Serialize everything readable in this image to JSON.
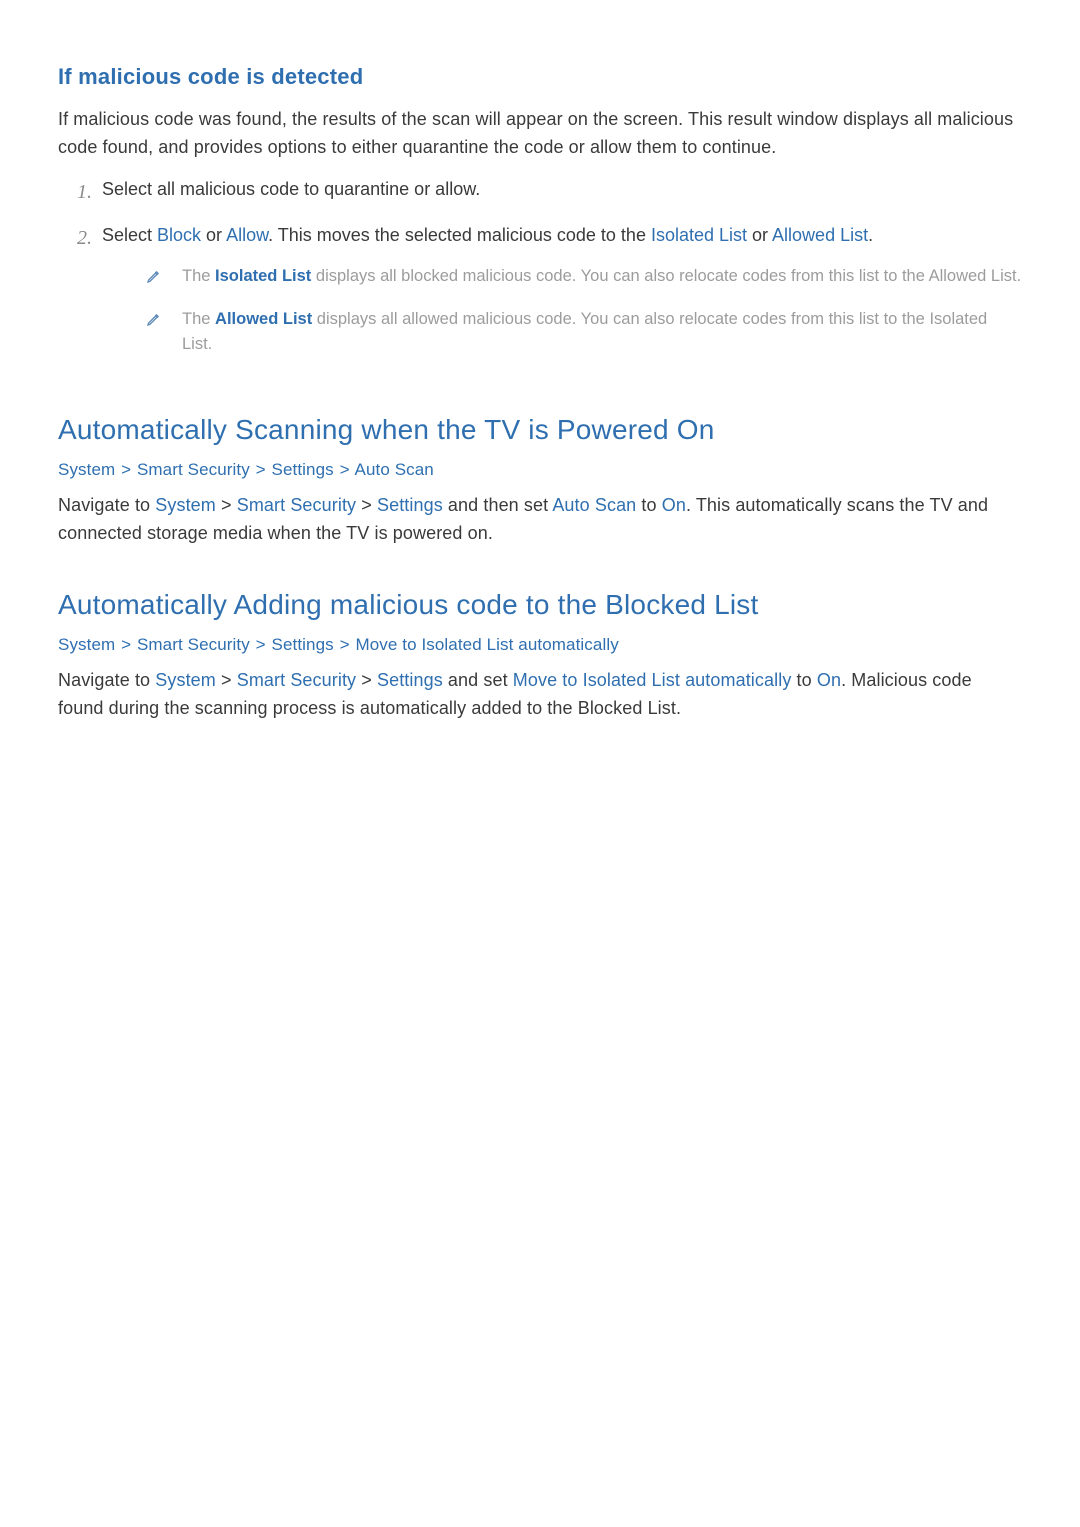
{
  "section1": {
    "heading": "If malicious code is detected",
    "intro": "If malicious code was found, the results of the scan will appear on the screen. This result window displays all malicious code found, and provides options to either quarantine the code or allow them to continue.",
    "steps": {
      "num1": "1.",
      "text1": "Select all malicious code to quarantine or allow.",
      "num2": "2.",
      "text2_pre": "Select ",
      "block": "Block",
      "text2_or": " or ",
      "allow": "Allow",
      "text2_mid": ". This moves the selected malicious code to the ",
      "isolated": "Isolated List",
      "text2_or2": " or ",
      "allowed": "Allowed List",
      "text2_end": "."
    },
    "notes": {
      "n1_pre": "The ",
      "n1_bold": "Isolated List",
      "n1_post": " displays all blocked malicious code. You can also relocate codes from this list to the Allowed List.",
      "n2_pre": "The ",
      "n2_bold": "Allowed List",
      "n2_post": " displays all allowed malicious code. You can also relocate codes from this list to the Isolated List."
    }
  },
  "section2": {
    "heading": "Automatically Scanning when the TV is Powered On",
    "bc": {
      "a": "System",
      "b": "Smart Security",
      "c": "Settings",
      "d": "Auto Scan"
    },
    "body": {
      "pre": "Navigate to ",
      "system": "System",
      "sep": " > ",
      "smart": "Smart Security",
      "settings": "Settings",
      "mid": " and then set ",
      "auto": "Auto Scan",
      "to": " to ",
      "on": "On",
      "post": ". This automatically scans the TV and connected storage media when the TV is powered on."
    }
  },
  "section3": {
    "heading": "Automatically Adding malicious code to the Blocked List",
    "bc": {
      "a": "System",
      "b": "Smart Security",
      "c": "Settings",
      "d": "Move to Isolated List automatically"
    },
    "body": {
      "pre": "Navigate to ",
      "system": "System",
      "sep": " > ",
      "smart": "Smart Security",
      "settings": "Settings",
      "mid": " and set ",
      "move": "Move to Isolated List automatically",
      "to": " to ",
      "on": "On",
      "post": ". Malicious code found during the scanning process is automatically added to the Blocked List."
    }
  },
  "chevron": ">"
}
